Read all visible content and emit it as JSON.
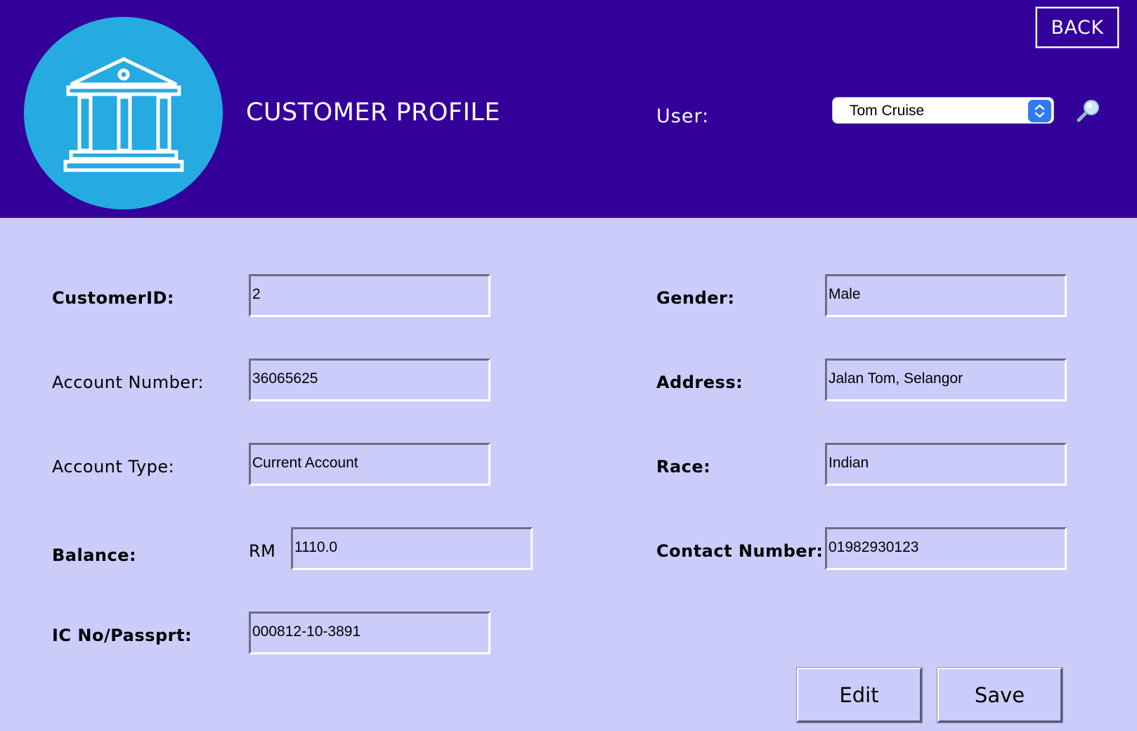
{
  "header": {
    "title": "CUSTOMER PROFILE",
    "user_label": "User:",
    "selected_user": "Tom Cruise",
    "back_label": "BACK"
  },
  "form": {
    "customer_id": {
      "label": "CustomerID:",
      "value": "2"
    },
    "account_number": {
      "label": "Account Number:",
      "value": "36065625"
    },
    "account_type": {
      "label": "Account Type:",
      "value": "Current Account"
    },
    "balance": {
      "label": "Balance:",
      "currency": "RM",
      "value": "1110.0"
    },
    "ic_no": {
      "label": "IC No/Passprt:",
      "value": "000812-10-3891"
    },
    "gender": {
      "label": "Gender:",
      "value": "Male"
    },
    "address": {
      "label": "Address:",
      "value": "Jalan Tom, Selangor"
    },
    "race": {
      "label": "Race:",
      "value": "Indian"
    },
    "contact_number": {
      "label": "Contact Number:",
      "value": "01982930123"
    }
  },
  "actions": {
    "edit_label": "Edit",
    "save_label": "Save"
  },
  "colors": {
    "header_bg": "#330099",
    "body_bg": "#ccccfb",
    "logo_bg": "#25aae1",
    "select_arrow_bg": "#2f7bf2"
  },
  "icons": {
    "logo": "bank-building-icon",
    "search": "search-icon",
    "select": "chevron-up-down-icon"
  }
}
